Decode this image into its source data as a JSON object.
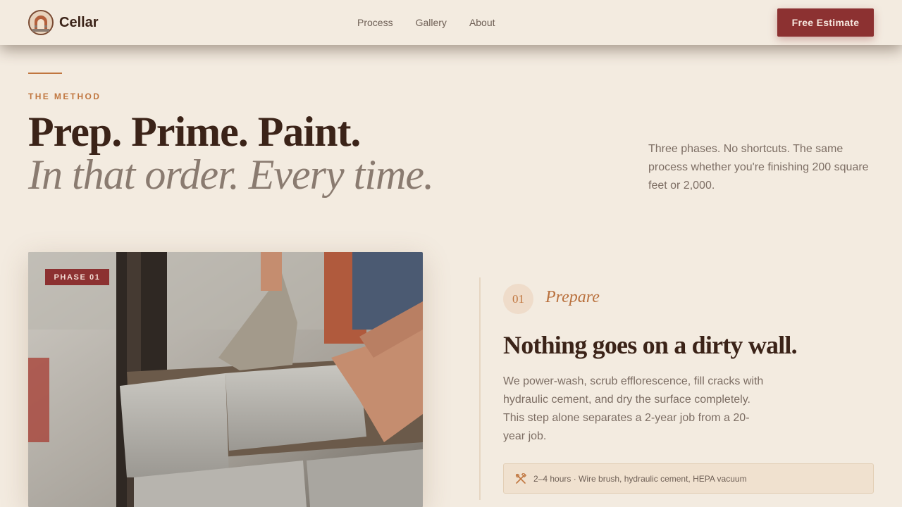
{
  "header": {
    "brand": "Cellar",
    "nav": [
      "Process",
      "Gallery",
      "About"
    ],
    "cta_label": "Free Estimate"
  },
  "hero": {
    "eyebrow": "THE METHOD",
    "title": "Prep. Prime. Paint.",
    "subtitle": "In that order. Every time.",
    "intro": "Three phases. No shortcuts. The same process whether you're finishing 200 square feet or 2,000."
  },
  "phase": {
    "badge": "PHASE 01",
    "number": "01",
    "name": "Prepare",
    "title": "Nothing goes on a dirty wall.",
    "body": "We power-wash, scrub efflorescence, fill cracks with hydraulic cement, and dry the surface completely. This step alone separates a 2-year job from a 20-year job.",
    "meta": "2–4 hours · Wire brush, hydraulic cement, HEPA vacuum",
    "meta_icon": "tools-icon"
  },
  "colors": {
    "accent": "#8c3131",
    "copper": "#c0763f",
    "background": "#f3ebe0",
    "ink": "#3b2318"
  }
}
